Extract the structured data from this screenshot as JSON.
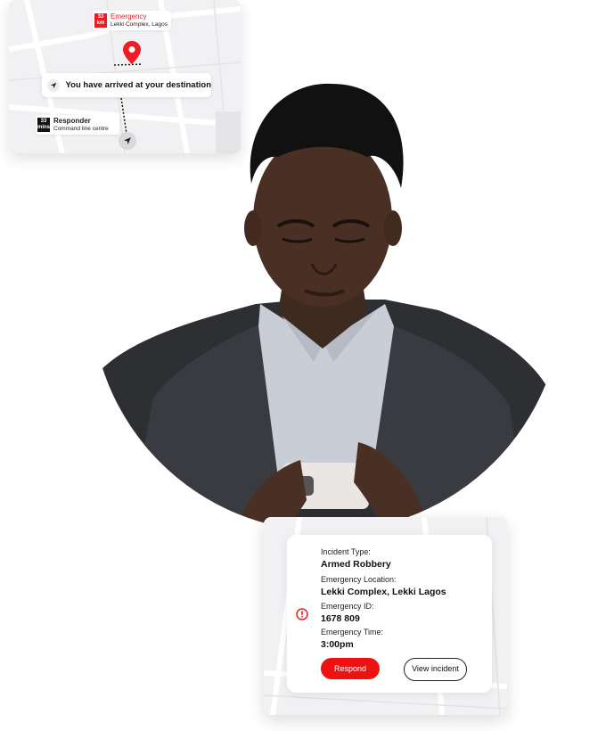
{
  "map_card": {
    "emergency": {
      "distance_value": "33",
      "distance_unit": "km",
      "title": "Emergency",
      "location": "Lekki Complex, Lagos"
    },
    "arrival_message": "You have arrived at your destination",
    "responder": {
      "eta_value": "33",
      "eta_unit": "mins",
      "title": "Responder",
      "location": "Command line centre"
    }
  },
  "incident": {
    "type_label": "Incident Type:",
    "type_value": "Armed Robbery",
    "location_label": "Emergency Location:",
    "location_value": "Lekki Complex, Lekki Lagos",
    "id_label": "Emergency ID:",
    "id_value": "1678 809",
    "time_label": "Emergency Time:",
    "time_value": "3:00pm",
    "respond_button": "Respond",
    "view_button": "View incident"
  },
  "colors": {
    "accent": "#ef1c24",
    "text": "#111111",
    "map_bg": "#f1f1f3"
  }
}
